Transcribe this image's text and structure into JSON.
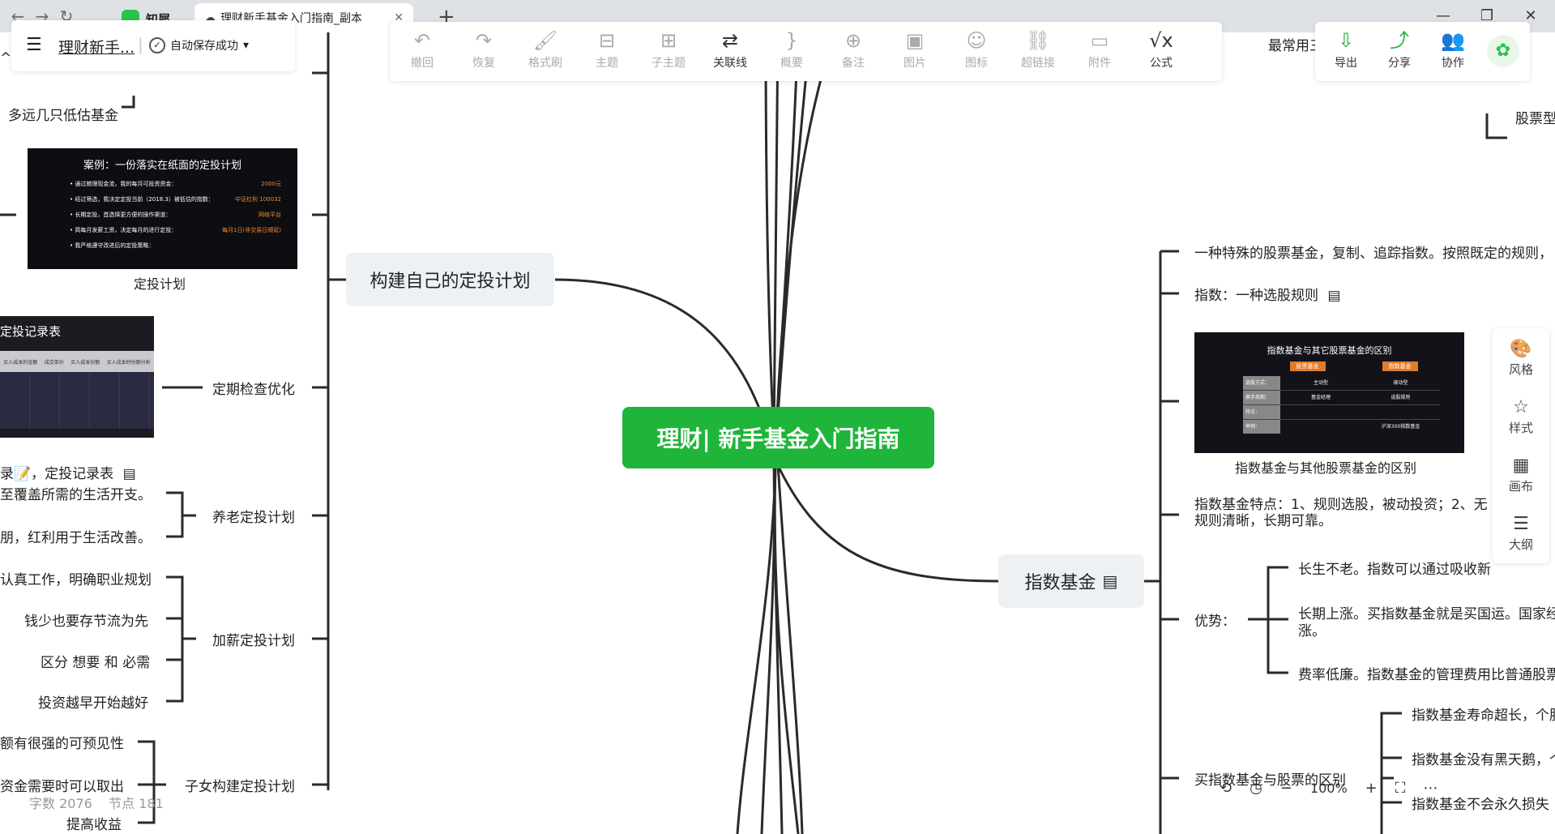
{
  "browser": {
    "app_tab": "知犀",
    "doc_tab": "理财新手基金入门指南_副本",
    "new_tab": "+",
    "back": "←",
    "forward": "→",
    "reload": "↻",
    "win_min": "—",
    "win_max": "❐",
    "win_close": "✕"
  },
  "doc": {
    "title": "理财新手...",
    "save_status": "自动保存成功",
    "save_caret": "▾"
  },
  "toolbar": [
    {
      "label": "撤回",
      "icon": "↶",
      "enabled": false
    },
    {
      "label": "恢复",
      "icon": "↷",
      "enabled": false
    },
    {
      "label": "格式刷",
      "icon": "🖌",
      "enabled": false
    },
    {
      "label": "主题",
      "icon": "⊟",
      "enabled": false
    },
    {
      "label": "子主题",
      "icon": "⊞",
      "enabled": false
    },
    {
      "label": "关联线",
      "icon": "⇄",
      "enabled": true
    },
    {
      "label": "概要",
      "icon": "}",
      "enabled": false
    },
    {
      "label": "备注",
      "icon": "⊕",
      "enabled": false
    },
    {
      "label": "图片",
      "icon": "▣",
      "enabled": false
    },
    {
      "label": "图标",
      "icon": "☺",
      "enabled": false
    },
    {
      "label": "超链接",
      "icon": "⛓",
      "enabled": false
    },
    {
      "label": "附件",
      "icon": "▭",
      "enabled": false
    },
    {
      "label": "公式",
      "icon": "√x",
      "enabled": true
    }
  ],
  "rightbar": [
    {
      "label": "导出",
      "icon": "⇩"
    },
    {
      "label": "分享",
      "icon": "⤴"
    },
    {
      "label": "协作",
      "icon": "👥"
    }
  ],
  "side_panel": [
    {
      "label": "风格",
      "icon": "🎨"
    },
    {
      "label": "样式",
      "icon": "☆"
    },
    {
      "label": "画布",
      "icon": "▦"
    },
    {
      "label": "大纲",
      "icon": "☰"
    }
  ],
  "root": {
    "label": "理财| 新手基金入门指南",
    "color": "#1fb53a"
  },
  "left": {
    "topic": "构建自己的定投计划",
    "top_fragment_1": "^",
    "top_fragment_2": "多远几只低估基金",
    "plan_image": {
      "title": "案例：一份落实在纸面的定投计划",
      "lines": [
        [
          "• 通过梳理现金流，我的每月可投资资金：",
          "2000元"
        ],
        [
          "• 经过筛选，我决定定投当前（2018.3）被低估的指数：",
          "中证红利 100032"
        ],
        [
          "• 长期定投，首选择更方便的操作渠道：",
          "网络平台"
        ],
        [
          "• 简每月发薪工资，决定每月的进行定投：",
          "每月1日(非交易日顺延)"
        ],
        [
          "• 我严格遵守改进后的定投策略：",
          ""
        ]
      ],
      "caption": "定投计划"
    },
    "record_image": {
      "title": "定投记录表",
      "headers": [
        "买入成本的金额",
        "成交单价",
        "买入成本份额",
        "买入成本时份额分析"
      ]
    },
    "record_label": "录📝，定投记录表",
    "check": "定期检查优化",
    "retire": "养老定投计划",
    "retire_items": [
      "至覆盖所需的生活开支。",
      "朋，红利用于生活改善。"
    ],
    "raise": "加薪定投计划",
    "raise_items": [
      "认真工作，明确职业规划",
      "钱少也要存节流为先",
      "区分 想要 和 必需",
      "投资越早开始越好"
    ],
    "child": "子女构建定投计划",
    "child_items": [
      "额有很强的可预见性",
      "资金需要时可以取出",
      "提高收益"
    ]
  },
  "right": {
    "topic": "指数基金",
    "fragment_top": "最常用三类基金",
    "fragment_right": "股票型",
    "items": [
      "一种特殊的股票基金，复制、追踪指数。按照既定的规则，",
      "指数：一种选股规则"
    ],
    "image": {
      "title": "指数基金与其它股票基金的区别",
      "col1": "股票基金",
      "col2": "指数基金",
      "rows": [
        [
          "选股方式：",
          "主动型",
          "被动型"
        ],
        [
          "换手周期：",
          "基金经理",
          "选股规则"
        ],
        [
          "特点：",
          "",
          "",
          ""
        ],
        [
          "举例：",
          "",
          "沪深300指数基金"
        ]
      ],
      "caption": "指数基金与其他股票基金的区别"
    },
    "feature": "指数基金特点：1、规则选股，被动投资；2、无",
    "feature_2": "规则清晰，长期可靠。",
    "advantage": "优势：",
    "adv_items": [
      "长生不老。指数可以通过吸收新",
      "长期上涨。买指数基金就是买国运。国家经",
      "涨。",
      "费率低廉。指数基金的管理费用比普通股票"
    ],
    "buy": "买指数基金与股票的区别",
    "buy_items": [
      "指数基金寿命超长，个股",
      "指数基金没有黑天鹅，个",
      "指数基金不会永久损失"
    ]
  },
  "status": {
    "words_label": "字数",
    "words": "2076",
    "nodes_label": "节点",
    "nodes": "181",
    "zoom": "100%"
  },
  "colors": {
    "line": "#2a2a2a",
    "accent": "#1fb53a",
    "topic_bg": "#eef1f4"
  }
}
